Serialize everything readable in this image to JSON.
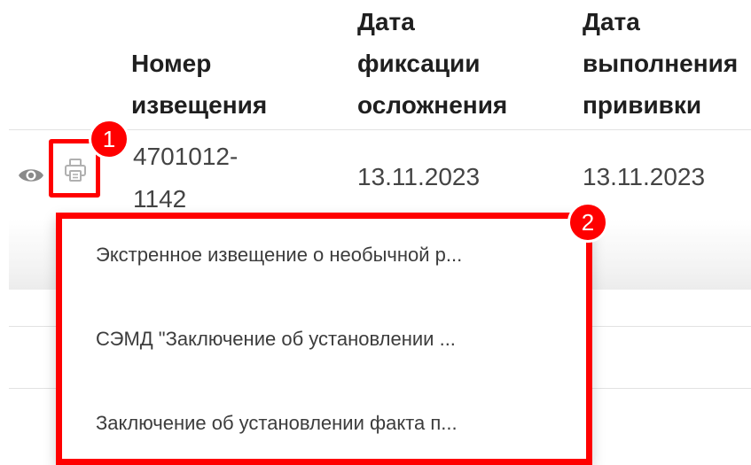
{
  "table": {
    "headers": {
      "number": [
        "Номер",
        "извещения"
      ],
      "fixation_date": [
        "Дата",
        "фиксации",
        "осложнения"
      ],
      "vaccination_date": [
        "Дата",
        "выполнения",
        "прививки"
      ]
    },
    "row": {
      "number": [
        "4701012-",
        "1142"
      ],
      "fixation_date": "13.11.2023",
      "vaccination_date": "13.11.2023"
    }
  },
  "print_menu": {
    "items": [
      "Экстренное извещение о необычной р...",
      "СЭМД \"Заключение об установлении ...",
      "Заключение об установлении факта п..."
    ]
  },
  "markers": {
    "print_button": "1",
    "print_menu": "2"
  },
  "colors": {
    "highlight": "#ff0000",
    "icon": "#8a8a8a",
    "text": "#444444"
  },
  "icons": {
    "view": "eye-icon",
    "print": "printer-icon"
  }
}
